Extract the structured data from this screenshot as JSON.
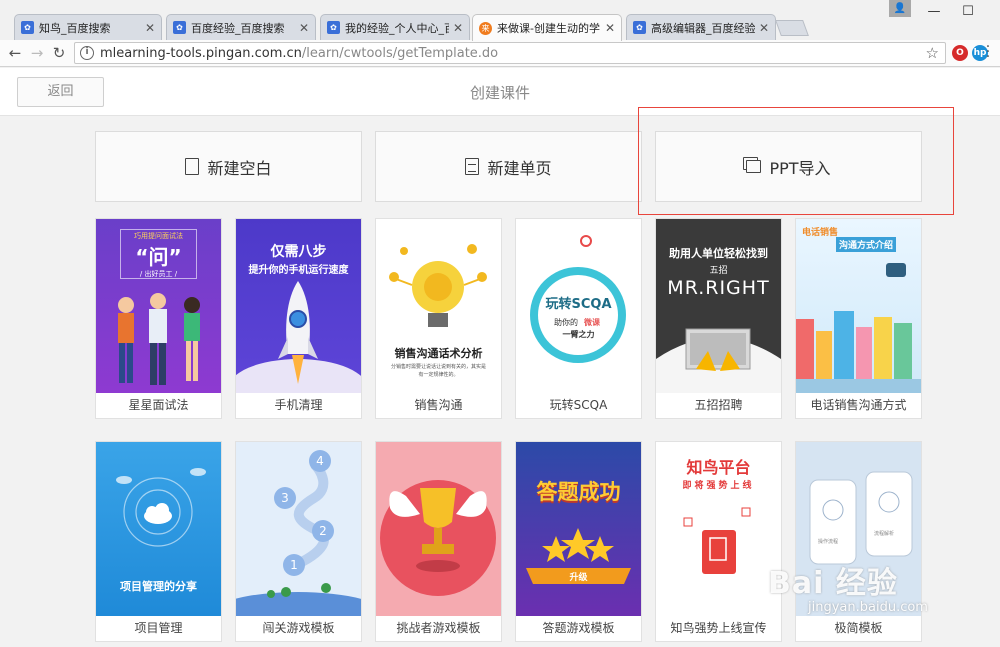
{
  "browser": {
    "tabs": [
      {
        "title": "知鸟_百度搜索",
        "favicon": "baidu-paw-icon"
      },
      {
        "title": "百度经验_百度搜索",
        "favicon": "baidu-paw-icon"
      },
      {
        "title": "我的经验_个人中心_百度",
        "favicon": "baidu-paw-icon"
      },
      {
        "title": "来做课-创建生动的学习",
        "favicon": "laizuoke-icon",
        "active": true
      },
      {
        "title": "高级编辑器_百度经验",
        "favicon": "baidu-paw-icon"
      }
    ],
    "url_host": "mlearning-tools.pingan.com.cn",
    "url_path": "/learn/cwtools/getTemplate.do"
  },
  "header": {
    "back_label": "返回",
    "title": "创建课件"
  },
  "actions": [
    {
      "label": "新建空白",
      "icon": "blank-page-icon"
    },
    {
      "label": "新建单页",
      "icon": "single-page-icon"
    },
    {
      "label": "PPT导入",
      "icon": "ppt-import-icon"
    }
  ],
  "templates": [
    {
      "label": "星星面试法",
      "thumb_lines": [
        "巧用提问面试法",
        "“问”",
        "/ 出好员工 /"
      ]
    },
    {
      "label": "手机清理",
      "thumb_lines": [
        "仅需八步",
        "提升你的手机运行速度"
      ]
    },
    {
      "label": "销售沟通",
      "thumb_lines": [
        "销售沟通话术分析",
        "分销售时需要让说话让说到有关的，其实是",
        "有一定规律性的。"
      ]
    },
    {
      "label": "玩转SCQA",
      "thumb_lines": [
        "玩转SCQA",
        "助你的",
        "微课",
        "一臂之力"
      ]
    },
    {
      "label": "五招招聘",
      "thumb_lines": [
        "助用人单位轻松找到",
        "五招",
        "MR.RIGHT"
      ]
    },
    {
      "label": "电话销售沟通方式",
      "thumb_lines": [
        "电话销售",
        "沟通方式介绍"
      ]
    },
    {
      "label": "项目管理",
      "thumb_lines": [
        "项目管理的分享"
      ]
    },
    {
      "label": "闯关游戏模板",
      "thumb_lines": [
        "4",
        "3",
        "2",
        "1"
      ]
    },
    {
      "label": "挑战者游戏模板",
      "thumb_lines": []
    },
    {
      "label": "答题游戏模板",
      "thumb_lines": [
        "答题成功",
        "升级"
      ]
    },
    {
      "label": "知鸟强势上线宣传",
      "thumb_lines": [
        "知鸟平台",
        "即将强势上线"
      ]
    },
    {
      "label": "极简模板",
      "thumb_lines": [
        "操作流程",
        "流程解析"
      ]
    }
  ],
  "watermark": {
    "text": "Bai 经验",
    "sub": "jingyan.baidu.com"
  }
}
